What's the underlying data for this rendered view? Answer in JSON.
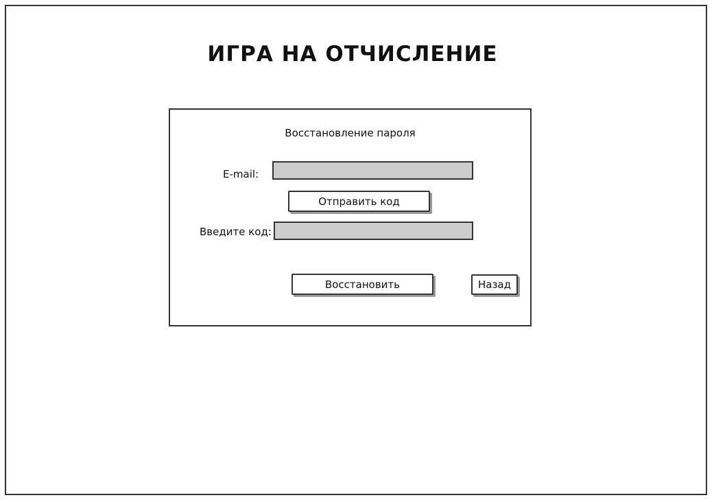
{
  "app": {
    "title": "ИГРА НА ОТЧИСЛЕНИЕ"
  },
  "form": {
    "heading": "Восстановление пароля",
    "email": {
      "label": "E-mail:",
      "value": ""
    },
    "send_code_label": "Отправить код",
    "code": {
      "label": "Введите код:",
      "value": ""
    },
    "restore_label": "Восстановить",
    "back_label": "Назад"
  },
  "colors": {
    "field_fill": "#cccccc",
    "border": "#333333",
    "button_shadow": "#9a9a9a"
  }
}
